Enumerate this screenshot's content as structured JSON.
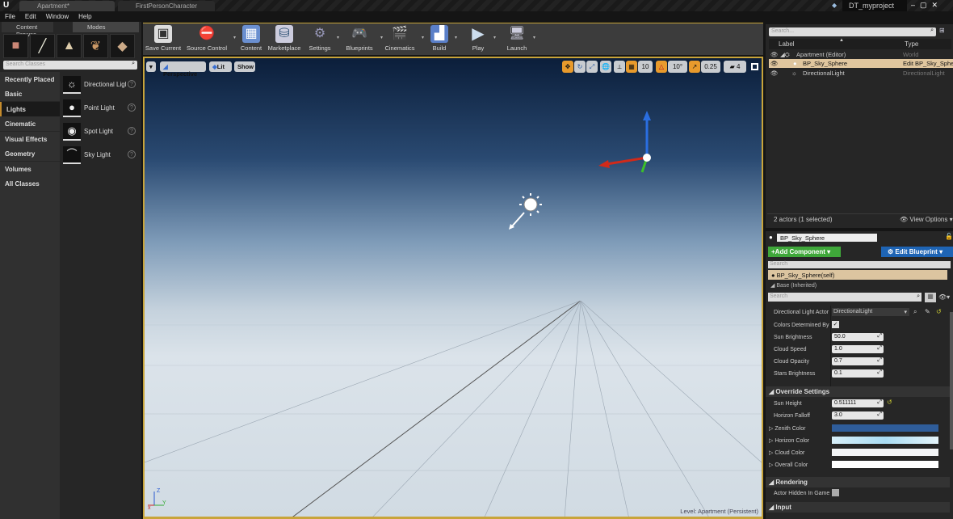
{
  "titlebar": {
    "tabs": [
      "Apartment*",
      "FirstPersonCharacter"
    ],
    "project": "DT_myproject",
    "logo": "U"
  },
  "menu": [
    "File",
    "Edit",
    "Window",
    "Help"
  ],
  "left_panel": {
    "tabs": [
      "Content Browse",
      "Modes"
    ],
    "search_placeholder": "Search Classes",
    "categories": [
      "Recently Placed",
      "Basic",
      "Lights",
      "Cinematic",
      "Visual Effects",
      "Geometry",
      "Volumes",
      "All Classes"
    ],
    "selected_category": "Lights",
    "items": [
      {
        "label": "Directional Light",
        "icon": "directional-light-icon"
      },
      {
        "label": "Point Light",
        "icon": "point-light-icon"
      },
      {
        "label": "Spot Light",
        "icon": "spot-light-icon"
      },
      {
        "label": "Sky Light",
        "icon": "sky-light-icon"
      }
    ]
  },
  "toolbar": [
    "Save Current",
    "Source Control",
    "Content",
    "Marketplace",
    "Settings",
    "Blueprints",
    "Cinematics",
    "Build",
    "Play",
    "Launch"
  ],
  "viewport": {
    "view_mode": "Perspective",
    "lighting": "Lit",
    "show": "Show",
    "grid_snap": "10",
    "rotation_snap": "10°",
    "scale_snap": "0.25",
    "camera_speed": "4",
    "level": "Level:  Apartment (Persistent)"
  },
  "outliner": {
    "search_placeholder": "Search...",
    "col_label": "Label",
    "col_type": "Type",
    "rows": [
      {
        "label": "Apartment (Editor)",
        "type": "World"
      },
      {
        "label": "BP_Sky_Sphere",
        "type": "Edit BP_Sky_Sphere"
      },
      {
        "label": "DirectionalLight",
        "type": "DirectionalLight"
      }
    ],
    "status": "2 actors (1 selected)",
    "view_options": "View Options"
  },
  "details": {
    "name": "BP_Sky_Sphere",
    "add_component": "+Add Component",
    "edit_blueprint": "Edit Blueprint",
    "search_placeholder": "Search",
    "self": "BP_Sky_Sphere(self)",
    "base": "Base (Inherited)",
    "props": [
      {
        "label": "Directional Light Actor",
        "value": "DirectionalLight"
      },
      {
        "label": "Colors Determined By",
        "value": "checked"
      },
      {
        "label": "Sun Brightness",
        "value": "50.0"
      },
      {
        "label": "Cloud Speed",
        "value": "1.0"
      },
      {
        "label": "Cloud Opacity",
        "value": "0.7"
      },
      {
        "label": "Stars Brightness",
        "value": "0.1"
      }
    ],
    "override": {
      "title": "Override Settings",
      "sun_height_label": "Sun Height",
      "sun_height": "0.511111",
      "horizon_falloff_label": "Horizon Falloff",
      "horizon_falloff": "3.0",
      "colors": [
        {
          "label": "Zenith Color",
          "color": "#2f5d9a"
        },
        {
          "label": "Horizon Color",
          "color": "#bfe4f5"
        },
        {
          "label": "Cloud Color",
          "color": "#f2f4f6"
        },
        {
          "label": "Overall Color",
          "color": "#ffffff"
        }
      ]
    },
    "rendering": {
      "title": "Rendering",
      "hidden_label": "Actor Hidden In Game"
    },
    "input": {
      "title": "Input"
    }
  }
}
